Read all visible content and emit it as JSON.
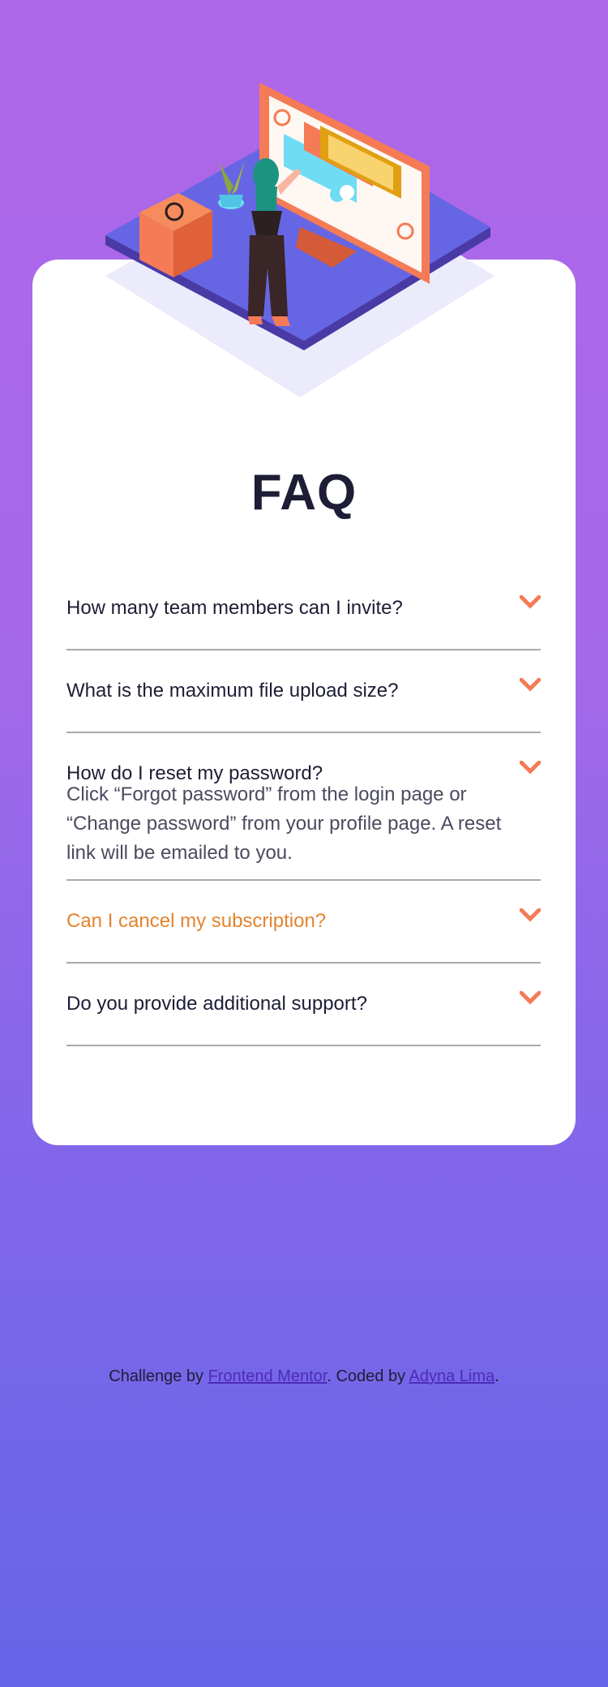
{
  "title": "FAQ",
  "accent_color": "#f47b56",
  "hover_color": "#e2842f",
  "faq": [
    {
      "question": "How many team members can I invite?",
      "open": false
    },
    {
      "question": "What is the maximum file upload size?",
      "open": false
    },
    {
      "question": "How do I reset my password?",
      "open": true,
      "answer": "Click “Forgot password” from the login page or “Change password” from your profile page. A reset link will be emailed to you."
    },
    {
      "question": "Can I cancel my subscription?",
      "open": false,
      "hovered": true
    },
    {
      "question": "Do you provide additional support?",
      "open": false
    }
  ],
  "footer": {
    "prefix": "Challenge by ",
    "link1": "Frontend Mentor",
    "middle": ". Coded by ",
    "link2": "Adyna Lima",
    "suffix": "."
  },
  "icons": {
    "chevron": "chevron-down-icon",
    "illustration": "woman-online-illustration"
  }
}
